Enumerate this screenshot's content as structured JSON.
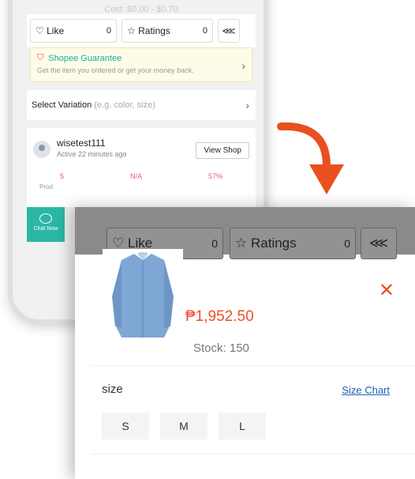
{
  "phone": {
    "cost": "Cost: $0.00 - $0.70",
    "like_label": "Like",
    "like_count": "0",
    "ratings_label": "Ratings",
    "ratings_count": "0",
    "guarantee_title": "Shopee Guarantee",
    "guarantee_sub": "Get the item you ordered or get your money back.",
    "variation_label": "Select Variation",
    "variation_hint": "(e.g. color, size)",
    "shop_name": "wisetest111",
    "shop_active": "Active 22 minutes ago",
    "view_shop": "View Shop",
    "stat1": "5",
    "stat2": "N/A",
    "stat3": "57%",
    "prod_label": "Prod",
    "chat_label": "Chat Now"
  },
  "popup": {
    "like_label": "Like",
    "like_count": "0",
    "ratings_label": "Ratings",
    "ratings_count": "0",
    "price": "₱1,952.50",
    "stock": "Stock: 150",
    "size_label": "size",
    "size_chart": "Size Chart",
    "sizes": [
      "S",
      "M",
      "L"
    ]
  },
  "colors": {
    "accent": "#ee4d2d",
    "teal": "#2cb7a5",
    "link": "#1a5fb4"
  }
}
